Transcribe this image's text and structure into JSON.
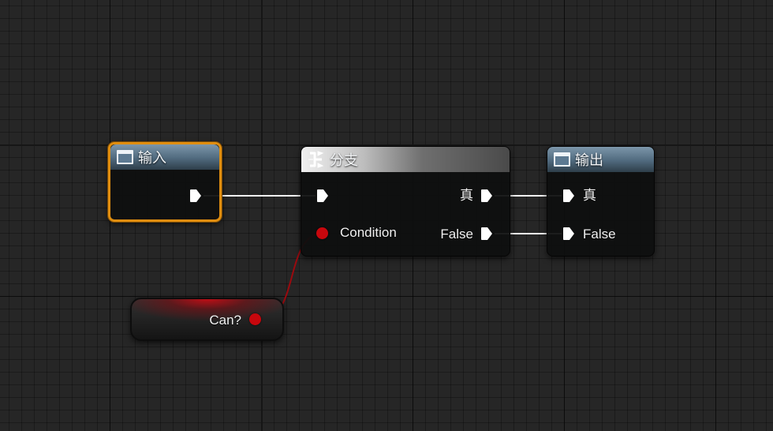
{
  "graph": {
    "event_in": {
      "title": "输入"
    },
    "branch": {
      "title": "分支",
      "condition_label": "Condition",
      "true_label": "真",
      "false_label": "False"
    },
    "event_out": {
      "title": "输出",
      "true_label": "真",
      "false_label": "False"
    },
    "variable": {
      "label": "Can?"
    }
  },
  "colors": {
    "selection": "#e08e10",
    "bool_pin": "#c8070d",
    "exec_wire": "#ffffff",
    "data_wire": "#9a0a0f",
    "event_header": "#5a748a"
  },
  "icons": {
    "event": "window-icon",
    "branch": "branch-icon",
    "exec_pin": "exec-pin-arrow",
    "data_pin": "bool-pin-dot"
  }
}
